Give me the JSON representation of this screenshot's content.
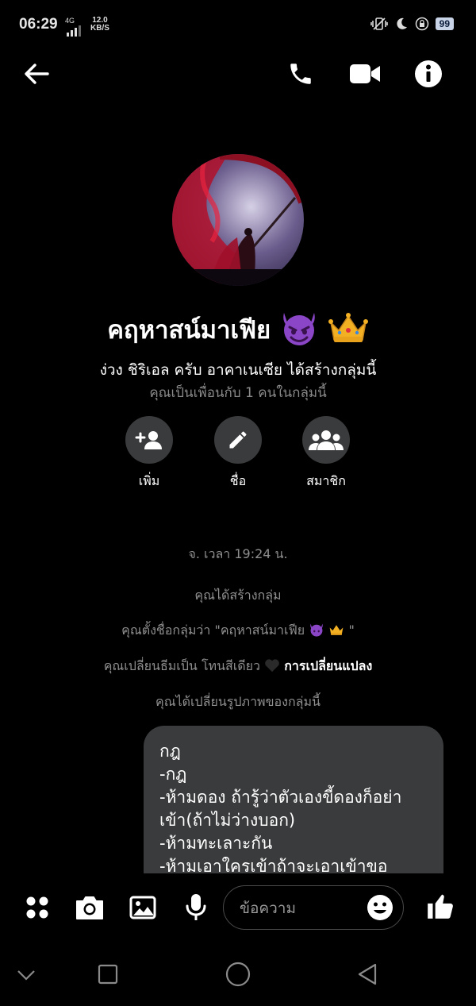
{
  "status_bar": {
    "time": "06:29",
    "network": "4G",
    "speed_value": "12.0",
    "speed_unit": "KB/S",
    "battery": "99"
  },
  "group": {
    "name": "คฤหาสน์มาเฟีย",
    "created_by": "ง่วง ชิริเอล ครับ อาคาเนเซีย ได้สร้างกลุ่มนี้",
    "friends_info": "คุณเป็นเพื่อนกับ 1 คนในกลุ่มนี้"
  },
  "actions": [
    {
      "label": "เพิ่ม"
    },
    {
      "label": "ชื่อ"
    },
    {
      "label": "สมาชิก"
    }
  ],
  "timeline": {
    "timestamp": "จ. เวลา 19:24 น.",
    "created_group": "คุณได้สร้างกลุ่ม",
    "named_group": "คุณตั้งชื่อกลุ่มว่า \"คฤหาสน์มาเฟีย",
    "named_group_end": "\"",
    "theme_changed": "คุณเปลี่ยนธีมเป็น โทนสีเดียว",
    "theme_change_link": "การเปลี่ยนแปลง",
    "photo_changed": "คุณได้เปลี่ยนรูปภาพของกลุ่มนี้"
  },
  "message": {
    "text": "กฎ\n-กฎ\n-ห้ามดอง ถ้ารู้ว่าตัวเองขี้ดองก็อย่าเข้า(ถ้าไม่ว่างบอก)\n-ห้ามทะเลาะกัน\n-ห้ามเอาใครเข้าถ้าจะเอาเข้าขอ"
  },
  "composer": {
    "placeholder": "ข้อความ"
  },
  "colors": {
    "background": "#000000",
    "bubble": "#3a3b3c",
    "secondary_text": "#8f8f8f"
  },
  "icons": [
    "back-arrow-icon",
    "phone-icon",
    "video-camera-icon",
    "info-icon",
    "add-person-icon",
    "pencil-icon",
    "people-icon",
    "apps-icon",
    "camera-icon",
    "image-icon",
    "microphone-icon",
    "emoji-icon",
    "thumbs-up-icon",
    "devil-emoji-icon",
    "crown-emoji-icon",
    "black-heart-icon"
  ]
}
